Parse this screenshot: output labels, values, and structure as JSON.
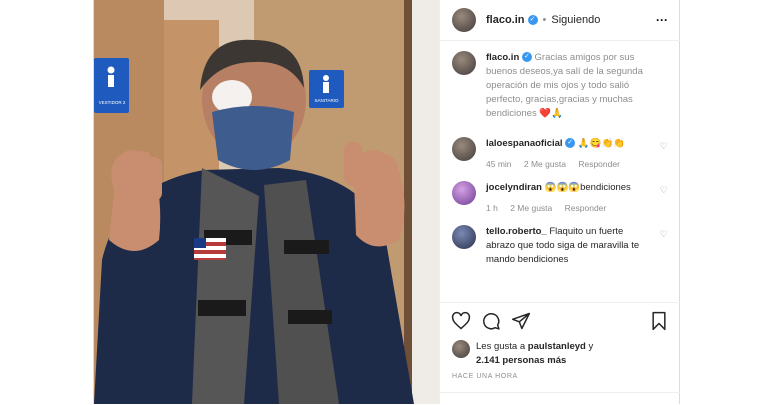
{
  "header": {
    "username": "flaco.in",
    "separator": "•",
    "follow_state": "Siguiendo",
    "more": "···",
    "verified": "✓"
  },
  "caption": {
    "username": "flaco.in",
    "text": "Gracias amigos por sus buenos deseos,ya salí de la segunda operación de mis ojos y todo salió perfecto, gracias,gracias y muchas bendiciones ❤️🙏"
  },
  "photo": {
    "door_sign_left": "VESTIDOR 2",
    "door_sign_right": "SANITARIO"
  },
  "comments": [
    {
      "username": "laloespanaoficial",
      "verified": "✓",
      "text": "🙏😋👏👏",
      "time": "45 min",
      "likes": "2 Me gusta",
      "reply": "Responder"
    },
    {
      "username": "jocelyndiran",
      "text": "😱😱😱bendiciones",
      "time": "1 h",
      "likes": "2 Me gusta",
      "reply": "Responder"
    },
    {
      "username": "tello.roberto_",
      "text": "Flaquito un fuerte abrazo que todo siga de maravilla te mando bendiciones",
      "time": "",
      "likes": "",
      "reply": ""
    }
  ],
  "likes": {
    "prefix": "Les gusta a",
    "user": "paulstanleyd",
    "joiner": "y",
    "count": "2.141 personas más"
  },
  "timestamp": "HACE UNA HORA",
  "colors": {
    "accent": "#3897f0",
    "heart": "#ed4956",
    "text": "#262626",
    "muted": "#8e8e8e"
  }
}
